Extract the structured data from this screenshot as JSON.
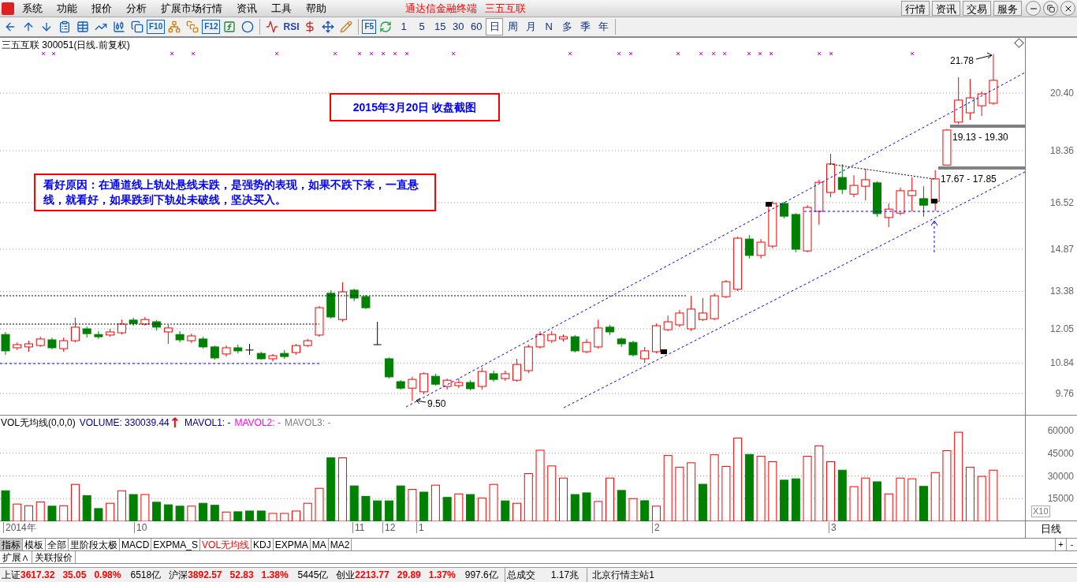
{
  "menu_bar": {
    "items": [
      "系统",
      "功能",
      "报价",
      "分析",
      "扩展市场行情",
      "资讯",
      "工具",
      "帮助"
    ],
    "app_title": "通达信金融终端",
    "stock_title": "三五互联",
    "buttons": [
      "行情",
      "资讯",
      "交易",
      "服务"
    ]
  },
  "toolbar": {
    "tool_labels": [
      "F10",
      "F12",
      "RSI",
      "F5"
    ],
    "periods": [
      {
        "label": "1",
        "selected": false
      },
      {
        "label": "5",
        "selected": false
      },
      {
        "label": "15",
        "selected": false
      },
      {
        "label": "30",
        "selected": false
      },
      {
        "label": "60",
        "selected": false
      },
      {
        "label": "日",
        "selected": true
      },
      {
        "label": "周",
        "selected": false
      },
      {
        "label": "月",
        "selected": false
      },
      {
        "label": "N",
        "selected": false
      },
      {
        "label": "多",
        "selected": false
      },
      {
        "label": "季",
        "selected": false
      },
      {
        "label": "年",
        "selected": false
      }
    ]
  },
  "price_chart": {
    "title": "三五互联 300051(日线.前复权)",
    "notes": [
      {
        "text": "2015年3月20日 收盘截图"
      },
      {
        "text": "看好原因：在通道线上轨处悬线未跌，是强势的表现，如果不跌下来，一直悬线，就看好，如果跌到下轨处未破线，坚决买入。"
      }
    ],
    "labels": [
      "21.78",
      "19.13 - 19.30",
      "17.67 - 17.85",
      "9.50"
    ],
    "chart_data": {
      "type": "candlestick",
      "ylim": [
        9.76,
        20.4
      ],
      "grid": true,
      "yticks": [
        {
          "value": 20.4,
          "label": "20.40"
        },
        {
          "value": 18.36,
          "label": "18.36"
        },
        {
          "value": 16.52,
          "label": "16.52"
        },
        {
          "value": 14.87,
          "label": "14.87"
        },
        {
          "value": 13.38,
          "label": "13.38"
        },
        {
          "value": 12.05,
          "label": "12.05"
        },
        {
          "value": 10.84,
          "label": "10.84"
        },
        {
          "value": 9.76,
          "label": "9.76"
        }
      ],
      "ohlc": [
        [
          11.85,
          11.94,
          11.13,
          11.27
        ],
        [
          11.38,
          11.57,
          11.3,
          11.49
        ],
        [
          11.41,
          11.63,
          11.24,
          11.52
        ],
        [
          11.46,
          11.77,
          11.41,
          11.69
        ],
        [
          11.66,
          11.74,
          11.32,
          11.38
        ],
        [
          11.35,
          11.74,
          11.24,
          11.63
        ],
        [
          11.63,
          12.44,
          11.57,
          12.11
        ],
        [
          12.05,
          12.13,
          11.74,
          11.88
        ],
        [
          11.85,
          11.97,
          11.69,
          11.77
        ],
        [
          11.83,
          12.05,
          11.77,
          11.94
        ],
        [
          11.91,
          12.38,
          11.85,
          12.22
        ],
        [
          12.36,
          12.44,
          12.16,
          12.24
        ],
        [
          12.22,
          12.47,
          12.16,
          12.38
        ],
        [
          12.3,
          12.36,
          11.99,
          12.11
        ],
        [
          11.94,
          12.19,
          11.52,
          12.08
        ],
        [
          11.85,
          11.97,
          11.57,
          11.66
        ],
        [
          11.63,
          11.88,
          11.55,
          11.8
        ],
        [
          11.69,
          11.77,
          11.35,
          11.41
        ],
        [
          11.41,
          11.46,
          10.96,
          11.02
        ],
        [
          11.16,
          11.46,
          11.07,
          11.38
        ],
        [
          11.38,
          11.49,
          11.18,
          11.27
        ],
        [
          11.3,
          11.52,
          11.13,
          11.3
        ],
        [
          11.18,
          11.24,
          10.96,
          10.99
        ],
        [
          10.99,
          11.16,
          10.9,
          11.1
        ],
        [
          11.18,
          11.3,
          10.99,
          11.07
        ],
        [
          11.21,
          11.52,
          11.13,
          11.46
        ],
        [
          11.46,
          11.69,
          11.41,
          11.63
        ],
        [
          11.83,
          12.86,
          11.77,
          12.8
        ],
        [
          13.31,
          13.42,
          12.41,
          12.47
        ],
        [
          12.38,
          13.7,
          12.3,
          13.36
        ],
        [
          13.42,
          13.47,
          13.03,
          13.14
        ],
        [
          13.19,
          13.25,
          12.75,
          12.8
        ],
        [
          11.49,
          12.3,
          11.49,
          11.49
        ],
        [
          10.99,
          11.04,
          10.29,
          10.35
        ],
        [
          10.18,
          10.23,
          9.9,
          9.95
        ],
        [
          9.95,
          10.35,
          9.5,
          10.26
        ],
        [
          9.82,
          10.51,
          9.73,
          10.46
        ],
        [
          10.37,
          10.46,
          10.04,
          10.09
        ],
        [
          10.01,
          10.29,
          9.9,
          10.23
        ],
        [
          10.04,
          10.29,
          9.95,
          10.15
        ],
        [
          10.15,
          10.23,
          9.87,
          9.93
        ],
        [
          10.01,
          10.68,
          9.9,
          10.54
        ],
        [
          10.46,
          10.57,
          10.18,
          10.26
        ],
        [
          10.29,
          10.57,
          10.21,
          10.46
        ],
        [
          10.23,
          10.99,
          10.18,
          10.79
        ],
        [
          10.57,
          11.49,
          10.49,
          11.41
        ],
        [
          11.41,
          11.97,
          11.35,
          11.85
        ],
        [
          11.63,
          11.97,
          11.55,
          11.85
        ],
        [
          11.69,
          11.85,
          11.6,
          11.77
        ],
        [
          11.77,
          11.83,
          11.21,
          11.27
        ],
        [
          11.24,
          11.69,
          11.18,
          11.57
        ],
        [
          11.41,
          12.38,
          11.35,
          12.08
        ],
        [
          12.11,
          12.19,
          11.83,
          11.94
        ],
        [
          11.69,
          11.74,
          11.41,
          11.52
        ],
        [
          11.57,
          11.63,
          11.07,
          11.13
        ],
        [
          10.99,
          11.41,
          10.85,
          11.27
        ],
        [
          11.24,
          12.24,
          11.18,
          12.16
        ],
        [
          12.02,
          12.52,
          11.97,
          12.3
        ],
        [
          12.19,
          12.72,
          12.11,
          12.61
        ],
        [
          12.05,
          13.22,
          11.97,
          12.75
        ],
        [
          12.38,
          13.14,
          12.33,
          12.61
        ],
        [
          12.41,
          13.31,
          12.36,
          13.22
        ],
        [
          13.19,
          13.78,
          13.14,
          13.72
        ],
        [
          13.45,
          15.32,
          13.39,
          15.26
        ],
        [
          15.23,
          15.37,
          14.54,
          14.65
        ],
        [
          14.65,
          15.23,
          14.54,
          15.12
        ],
        [
          14.98,
          16.57,
          14.9,
          16.49
        ],
        [
          16.49,
          16.55,
          15.96,
          16.04
        ],
        [
          16.1,
          16.15,
          14.76,
          14.87
        ],
        [
          14.81,
          16.43,
          14.76,
          16.35
        ],
        [
          16.21,
          17.33,
          15.74,
          17.24
        ],
        [
          16.88,
          18.25,
          16.71,
          17.89
        ],
        [
          17.41,
          17.89,
          16.82,
          16.99
        ],
        [
          16.82,
          17.49,
          16.71,
          17.13
        ],
        [
          17.1,
          17.72,
          16.6,
          17.33
        ],
        [
          17.22,
          17.27,
          16.02,
          16.13
        ],
        [
          15.99,
          16.49,
          15.65,
          16.29
        ],
        [
          16.15,
          17.05,
          16.07,
          16.94
        ],
        [
          16.77,
          17.41,
          16.21,
          16.94
        ],
        [
          16.66,
          17.1,
          16.02,
          16.43
        ],
        [
          16.57,
          17.67,
          16.24,
          17.36
        ],
        [
          17.85,
          19.13,
          17.85,
          19.09
        ],
        [
          19.37,
          20.96,
          19.3,
          20.15
        ],
        [
          19.7,
          20.9,
          19.45,
          20.23
        ],
        [
          19.95,
          20.46,
          19.59,
          20.37
        ],
        [
          20.04,
          21.78,
          19.98,
          20.85
        ]
      ]
    }
  },
  "volume_panel": {
    "legend": [
      {
        "text": "VOL无均线(0,0,0)",
        "color": "#000000"
      },
      {
        "text": "VOLUME: 330039.44",
        "color": "#000080"
      },
      {
        "text": "↑",
        "color": "#ff0000"
      },
      {
        "text": "MAVOL1: -",
        "color": "#000080"
      },
      {
        "text": "MAVOL2: -",
        "color": "#ff00ff"
      },
      {
        "text": "MAVOL3: -",
        "color": "#808080"
      }
    ],
    "unit": "X10",
    "chart_data": {
      "type": "bar",
      "stacked": true,
      "grid": true,
      "ylim": [
        0,
        60000
      ],
      "yticks": [
        60000,
        45000,
        30000,
        15000
      ],
      "series": [
        {
          "color": "#ff0000",
          "values": [
            null,
            11400,
            10300,
            12800,
            null,
            10300,
            24400,
            null,
            null,
            11900,
            20200,
            null,
            17700,
            null,
            null,
            null,
            10000,
            null,
            null,
            6100,
            null,
            null,
            null,
            5200,
            5200,
            6800,
            11900,
            21800,
            null,
            42000,
            null,
            null,
            null,
            null,
            null,
            21100,
            null,
            23900,
            null,
            18100,
            null,
            15300,
            24400,
            null,
            11900,
            31600,
            47000,
            36600,
            28600,
            null,
            null,
            13100,
            28600,
            null,
            15000,
            null,
            10000,
            43500,
            35800,
            38700,
            null,
            44000,
            36300,
            55000,
            null,
            43000,
            39400,
            null,
            null,
            43000,
            49900,
            39400,
            null,
            22900,
            28600,
            null,
            18100,
            28600,
            28100,
            null,
            32200,
            46700,
            58900,
            35800,
            29700,
            33800
          ]
        },
        {
          "color": "#008000",
          "values": [
            20200,
            null,
            null,
            null,
            10000,
            null,
            null,
            17000,
            8400,
            null,
            null,
            17700,
            null,
            12600,
            10900,
            10000,
            null,
            11900,
            10600,
            null,
            6300,
            6800,
            6800,
            null,
            null,
            null,
            null,
            null,
            42000,
            null,
            23400,
            16500,
            13500,
            13500,
            23400,
            null,
            19300,
            null,
            15800,
            null,
            17700,
            null,
            null,
            13500,
            null,
            null,
            null,
            null,
            null,
            17700,
            18800,
            null,
            null,
            20400,
            null,
            13600,
            null,
            null,
            null,
            null,
            24500,
            null,
            null,
            null,
            44200,
            null,
            null,
            27200,
            28100,
            null,
            null,
            null,
            33800,
            null,
            null,
            26100,
            null,
            null,
            null,
            23100,
            null,
            null,
            null,
            null,
            null,
            null
          ]
        }
      ]
    }
  },
  "date_axis": [
    "2014年",
    "10",
    "11",
    "12",
    "1",
    "2",
    "3"
  ],
  "period_label": "日线",
  "indicator_tabs": [
    {
      "label": "指标",
      "selected": true,
      "active": false
    },
    {
      "label": "模板",
      "selected": false,
      "active": false
    },
    {
      "label": "全部",
      "selected": false,
      "active": false
    },
    {
      "label": "里阶段太极",
      "selected": false,
      "active": false
    },
    {
      "label": "MACD",
      "selected": false,
      "active": false
    },
    {
      "label": "EXPMA_S",
      "selected": false,
      "active": false
    },
    {
      "label": "VOL无均线",
      "selected": false,
      "active": true
    },
    {
      "label": "KDJ",
      "selected": false,
      "active": false
    },
    {
      "label": "EXPMA",
      "selected": false,
      "active": false
    },
    {
      "label": "MA",
      "selected": false,
      "active": false
    },
    {
      "label": "MA2",
      "selected": false,
      "active": false
    }
  ],
  "zoom_buttons": [
    "+",
    "-"
  ],
  "bottom_tabs": [
    "扩展∧",
    "关联报价"
  ],
  "status_bar": {
    "indices": [
      {
        "name": "上证",
        "value": "3617.32",
        "change": "35.05",
        "percent": "0.98%",
        "amount": "6518亿"
      },
      {
        "name": "沪深",
        "value": "3892.57",
        "change": "52.83",
        "percent": "1.38%",
        "amount": "5445亿"
      },
      {
        "name": "创业",
        "value": "2213.77",
        "change": "29.89",
        "percent": "1.37%",
        "amount": "997.6亿"
      }
    ],
    "total_label": "总成交",
    "total": "1.17兆",
    "server": "北京行情主站1"
  }
}
